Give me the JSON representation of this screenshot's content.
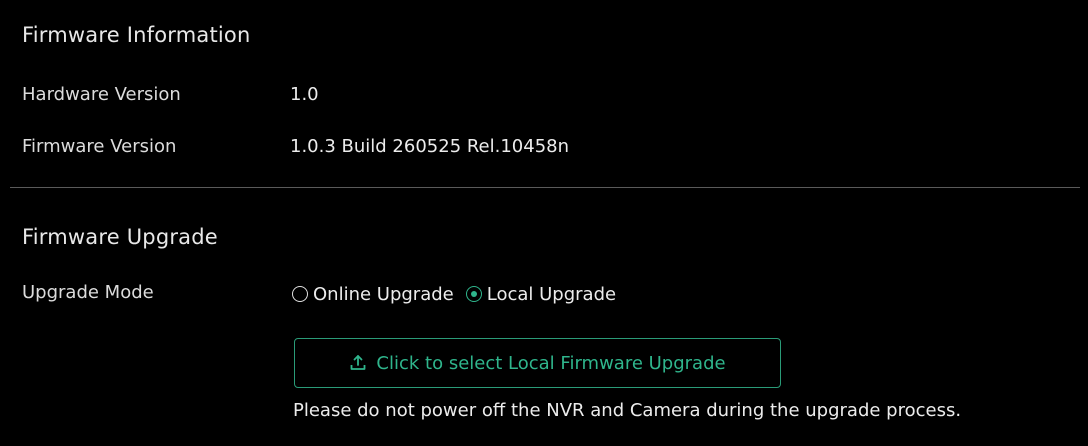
{
  "firmware_info": {
    "title": "Firmware Information",
    "hardware_version_label": "Hardware Version",
    "hardware_version_value": "1.0",
    "firmware_version_label": "Firmware Version",
    "firmware_version_value": "1.0.3 Build 260525 Rel.10458n"
  },
  "firmware_upgrade": {
    "title": "Firmware Upgrade",
    "mode_label": "Upgrade Mode",
    "options": [
      {
        "label": "Online Upgrade",
        "checked": false
      },
      {
        "label": "Local Upgrade",
        "checked": true
      }
    ],
    "upload_button_label": "Click to select Local Firmware Upgrade",
    "upload_icon": "upload-icon",
    "notice": "Please do not power off the NVR and Camera during the upgrade process."
  },
  "colors": {
    "background": "#000000",
    "accent": "#2fb58c",
    "text": "#ececec",
    "divider": "#5a5a5a"
  }
}
